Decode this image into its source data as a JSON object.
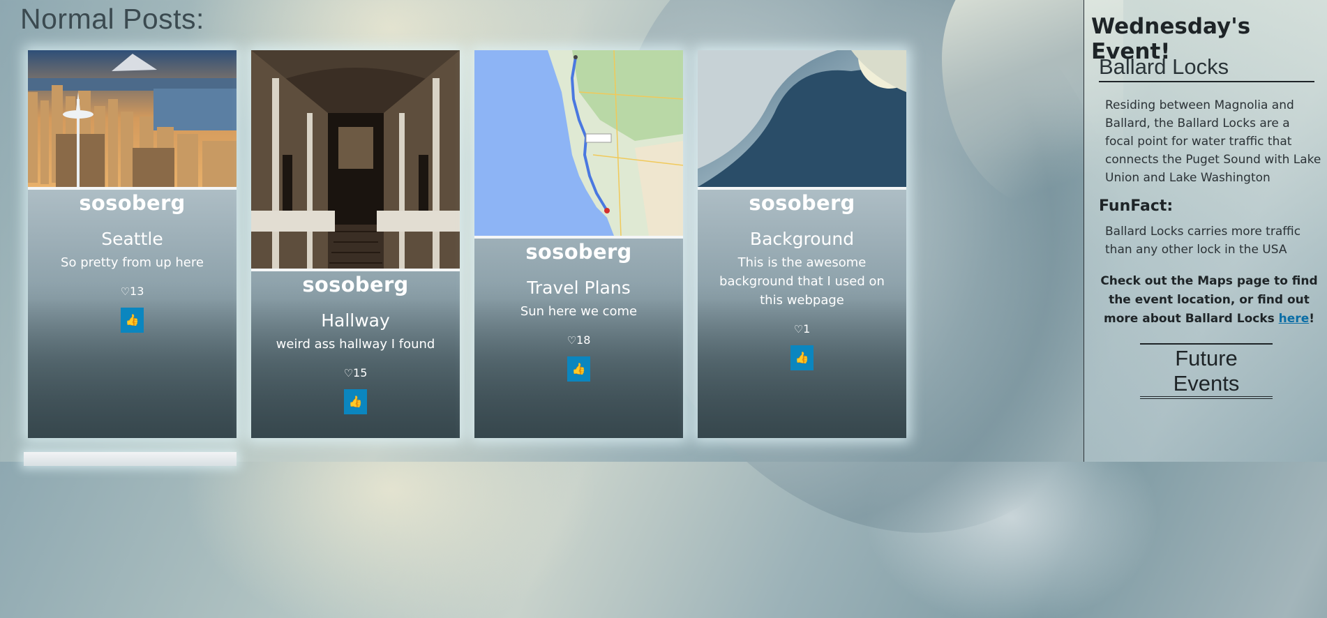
{
  "page_title": "Normal Posts:",
  "posts": [
    {
      "author": "sosoberg",
      "title": "Seattle",
      "description": "So pretty from up here",
      "likes": "13",
      "image": "seattle-skyline-image"
    },
    {
      "author": "sosoberg",
      "title": "Hallway",
      "description": "weird ass hallway I found",
      "likes": "15",
      "image": "hallway-image"
    },
    {
      "author": "sosoberg",
      "title": "Travel Plans",
      "description": "Sun here we come",
      "likes": "18",
      "image": "map-image"
    },
    {
      "author": "sosoberg",
      "title": "Background",
      "description": "This is the awesome background that I used on this webpage",
      "likes": "1",
      "image": "background-image"
    }
  ],
  "sidebar": {
    "heading": "Wednesday's Event!",
    "event_name": "Ballard Locks",
    "event_description": "Residing between Magnolia and Ballard, the Ballard Locks are a focal point for water traffic that connects the Puget Sound with Lake Union and Lake Washington",
    "funfact_heading": "FunFact:",
    "funfact_text": "Ballard Locks carries more traffic than any other lock in the USA",
    "callout_text": "Check out the Maps page to find the event location, or find out more about Ballard Locks ",
    "callout_link": "here",
    "callout_end": "!",
    "future_events": "Future Events"
  },
  "icons": {
    "heart": "heart-icon",
    "like": "thumbs-up-icon"
  },
  "colors": {
    "like_button": "#0b86bf",
    "link": "#0b6ea6"
  }
}
